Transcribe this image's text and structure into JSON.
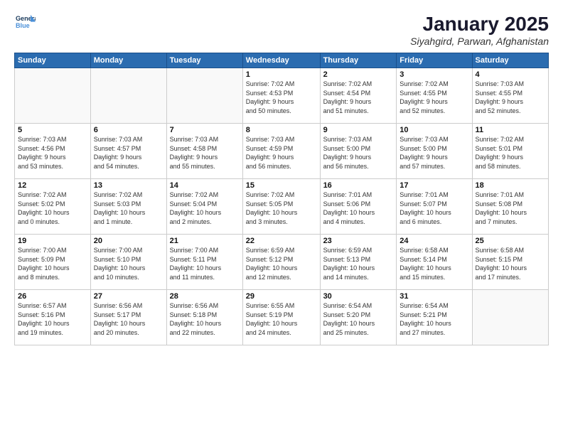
{
  "header": {
    "logo_line1": "General",
    "logo_line2": "Blue",
    "month": "January 2025",
    "location": "Siyahgird, Parwan, Afghanistan"
  },
  "weekdays": [
    "Sunday",
    "Monday",
    "Tuesday",
    "Wednesday",
    "Thursday",
    "Friday",
    "Saturday"
  ],
  "weeks": [
    [
      {
        "day": "",
        "info": ""
      },
      {
        "day": "",
        "info": ""
      },
      {
        "day": "",
        "info": ""
      },
      {
        "day": "1",
        "info": "Sunrise: 7:02 AM\nSunset: 4:53 PM\nDaylight: 9 hours\nand 50 minutes."
      },
      {
        "day": "2",
        "info": "Sunrise: 7:02 AM\nSunset: 4:54 PM\nDaylight: 9 hours\nand 51 minutes."
      },
      {
        "day": "3",
        "info": "Sunrise: 7:02 AM\nSunset: 4:55 PM\nDaylight: 9 hours\nand 52 minutes."
      },
      {
        "day": "4",
        "info": "Sunrise: 7:03 AM\nSunset: 4:55 PM\nDaylight: 9 hours\nand 52 minutes."
      }
    ],
    [
      {
        "day": "5",
        "info": "Sunrise: 7:03 AM\nSunset: 4:56 PM\nDaylight: 9 hours\nand 53 minutes."
      },
      {
        "day": "6",
        "info": "Sunrise: 7:03 AM\nSunset: 4:57 PM\nDaylight: 9 hours\nand 54 minutes."
      },
      {
        "day": "7",
        "info": "Sunrise: 7:03 AM\nSunset: 4:58 PM\nDaylight: 9 hours\nand 55 minutes."
      },
      {
        "day": "8",
        "info": "Sunrise: 7:03 AM\nSunset: 4:59 PM\nDaylight: 9 hours\nand 56 minutes."
      },
      {
        "day": "9",
        "info": "Sunrise: 7:03 AM\nSunset: 5:00 PM\nDaylight: 9 hours\nand 56 minutes."
      },
      {
        "day": "10",
        "info": "Sunrise: 7:03 AM\nSunset: 5:00 PM\nDaylight: 9 hours\nand 57 minutes."
      },
      {
        "day": "11",
        "info": "Sunrise: 7:02 AM\nSunset: 5:01 PM\nDaylight: 9 hours\nand 58 minutes."
      }
    ],
    [
      {
        "day": "12",
        "info": "Sunrise: 7:02 AM\nSunset: 5:02 PM\nDaylight: 10 hours\nand 0 minutes."
      },
      {
        "day": "13",
        "info": "Sunrise: 7:02 AM\nSunset: 5:03 PM\nDaylight: 10 hours\nand 1 minute."
      },
      {
        "day": "14",
        "info": "Sunrise: 7:02 AM\nSunset: 5:04 PM\nDaylight: 10 hours\nand 2 minutes."
      },
      {
        "day": "15",
        "info": "Sunrise: 7:02 AM\nSunset: 5:05 PM\nDaylight: 10 hours\nand 3 minutes."
      },
      {
        "day": "16",
        "info": "Sunrise: 7:01 AM\nSunset: 5:06 PM\nDaylight: 10 hours\nand 4 minutes."
      },
      {
        "day": "17",
        "info": "Sunrise: 7:01 AM\nSunset: 5:07 PM\nDaylight: 10 hours\nand 6 minutes."
      },
      {
        "day": "18",
        "info": "Sunrise: 7:01 AM\nSunset: 5:08 PM\nDaylight: 10 hours\nand 7 minutes."
      }
    ],
    [
      {
        "day": "19",
        "info": "Sunrise: 7:00 AM\nSunset: 5:09 PM\nDaylight: 10 hours\nand 8 minutes."
      },
      {
        "day": "20",
        "info": "Sunrise: 7:00 AM\nSunset: 5:10 PM\nDaylight: 10 hours\nand 10 minutes."
      },
      {
        "day": "21",
        "info": "Sunrise: 7:00 AM\nSunset: 5:11 PM\nDaylight: 10 hours\nand 11 minutes."
      },
      {
        "day": "22",
        "info": "Sunrise: 6:59 AM\nSunset: 5:12 PM\nDaylight: 10 hours\nand 12 minutes."
      },
      {
        "day": "23",
        "info": "Sunrise: 6:59 AM\nSunset: 5:13 PM\nDaylight: 10 hours\nand 14 minutes."
      },
      {
        "day": "24",
        "info": "Sunrise: 6:58 AM\nSunset: 5:14 PM\nDaylight: 10 hours\nand 15 minutes."
      },
      {
        "day": "25",
        "info": "Sunrise: 6:58 AM\nSunset: 5:15 PM\nDaylight: 10 hours\nand 17 minutes."
      }
    ],
    [
      {
        "day": "26",
        "info": "Sunrise: 6:57 AM\nSunset: 5:16 PM\nDaylight: 10 hours\nand 19 minutes."
      },
      {
        "day": "27",
        "info": "Sunrise: 6:56 AM\nSunset: 5:17 PM\nDaylight: 10 hours\nand 20 minutes."
      },
      {
        "day": "28",
        "info": "Sunrise: 6:56 AM\nSunset: 5:18 PM\nDaylight: 10 hours\nand 22 minutes."
      },
      {
        "day": "29",
        "info": "Sunrise: 6:55 AM\nSunset: 5:19 PM\nDaylight: 10 hours\nand 24 minutes."
      },
      {
        "day": "30",
        "info": "Sunrise: 6:54 AM\nSunset: 5:20 PM\nDaylight: 10 hours\nand 25 minutes."
      },
      {
        "day": "31",
        "info": "Sunrise: 6:54 AM\nSunset: 5:21 PM\nDaylight: 10 hours\nand 27 minutes."
      },
      {
        "day": "",
        "info": ""
      }
    ]
  ]
}
